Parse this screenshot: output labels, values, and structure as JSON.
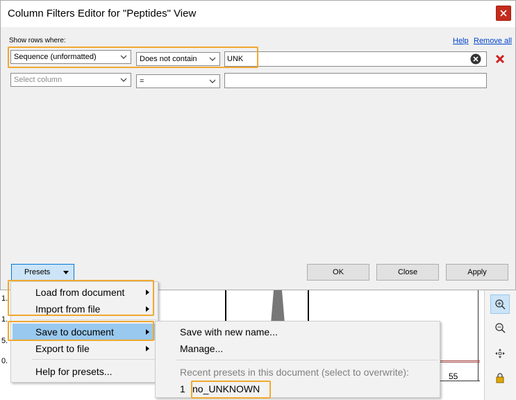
{
  "dialog": {
    "title": "Column Filters Editor for \"Peptides\" View",
    "show_rows_label": "Show rows where:",
    "help_label": "Help",
    "remove_all_label": "Remove all"
  },
  "filters": [
    {
      "column": "Sequence (unformatted)",
      "operator": "Does not contain",
      "value": "UNK"
    },
    {
      "column_placeholder": "Select column",
      "operator": "=",
      "value": ""
    }
  ],
  "buttons": {
    "presets": "Presets",
    "ok": "OK",
    "close": "Close",
    "apply": "Apply"
  },
  "presets_menu": {
    "items": [
      "Load from document",
      "Import from file",
      "Save to document",
      "Export to file",
      "Help for presets..."
    ]
  },
  "save_submenu": {
    "save_new": "Save with new name...",
    "manage": "Manage...",
    "recent_header": "Recent presets in this document (select to overwrite):",
    "recent_index": "1",
    "recent_name": "no_UNKNOWN"
  },
  "background_chart": {
    "tick_labels": [
      "1.",
      "1.",
      "5.",
      "0.",
      "55"
    ]
  },
  "colors": {
    "highlight": "#f0a830",
    "selected": "#99c9ef",
    "close_button": "#c42b1c",
    "link": "#0044cc"
  }
}
